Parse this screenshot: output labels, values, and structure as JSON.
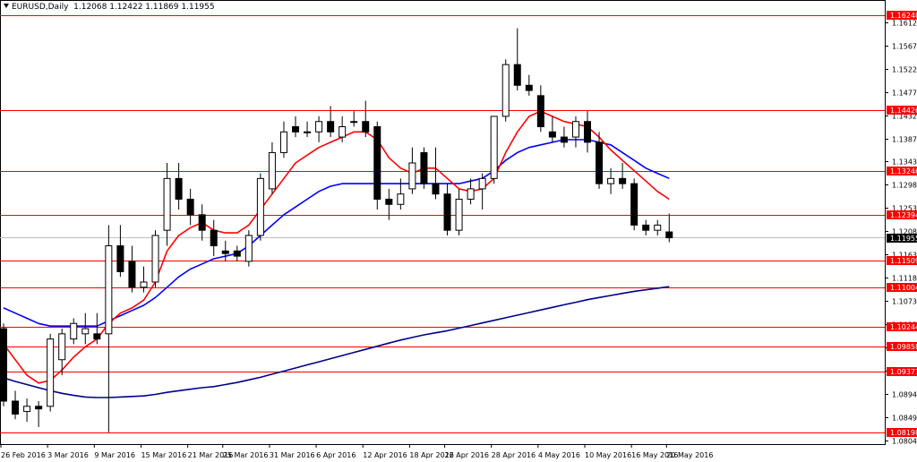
{
  "header": {
    "symbol": "EURUSD,Daily",
    "ohlc": "1.12068 1.12422 1.11869 1.11955"
  },
  "colors": {
    "up": "#ffffff",
    "down": "#000000",
    "level_line": "#ff0000",
    "ma_fast": "#ff0000",
    "ma_mid": "#0000ff",
    "ma_slow": "#00008b",
    "current_price_line": "#c0c0c0"
  },
  "chart_data": {
    "type": "candlestick",
    "y_range": [
      1.0797,
      1.1653
    ],
    "price_ticks": [
      "1.16120",
      "1.15670",
      "1.15220",
      "1.14770",
      "1.14320",
      "1.13870",
      "1.13430",
      "1.12980",
      "1.12530",
      "1.12080",
      "1.11630",
      "1.11180",
      "1.10730",
      "1.10280",
      "1.09840",
      "1.09390",
      "1.08940",
      "1.08490",
      "1.08040"
    ],
    "levels": [
      "1.16248",
      "1.14426",
      "1.13246",
      "1.12394",
      "1.11509",
      "1.11004",
      "1.10244",
      "1.09858",
      "1.09377",
      "1.08198"
    ],
    "current_price": "1.11955",
    "date_labels": [
      "26 Feb 2016",
      "3 Mar 2016",
      "9 Mar 2016",
      "15 Mar 2016",
      "21 Mar 2016",
      "25 Mar 2016",
      "31 Mar 2016",
      "6 Apr 2016",
      "12 Apr 2016",
      "18 Apr 2016",
      "22 Apr 2016",
      "28 Apr 2016",
      "4 May 2016",
      "10 May 2016",
      "16 May 2016",
      "20 May 2016"
    ],
    "date_label_index": [
      0,
      4,
      8,
      12,
      16,
      19,
      23,
      27,
      31,
      35,
      38,
      42,
      46,
      50,
      54,
      57
    ],
    "candles": [
      [
        1.102,
        1.103,
        1.087,
        1.088
      ],
      [
        1.088,
        1.09,
        1.0845,
        1.0855
      ],
      [
        1.086,
        1.0885,
        1.084,
        1.087
      ],
      [
        1.087,
        1.088,
        1.083,
        1.0865
      ],
      [
        1.087,
        1.101,
        1.086,
        1.1
      ],
      [
        1.096,
        1.102,
        1.093,
        1.101
      ],
      [
        1.1,
        1.104,
        1.099,
        1.103
      ],
      [
        1.101,
        1.105,
        1.099,
        1.102
      ],
      [
        1.101,
        1.105,
        1.099,
        1.1
      ],
      [
        1.101,
        1.122,
        1.082,
        1.118
      ],
      [
        1.118,
        1.122,
        1.112,
        1.113
      ],
      [
        1.115,
        1.118,
        1.109,
        1.11
      ],
      [
        1.11,
        1.114,
        1.109,
        1.111
      ],
      [
        1.111,
        1.121,
        1.11,
        1.12
      ],
      [
        1.121,
        1.134,
        1.118,
        1.131
      ],
      [
        1.131,
        1.134,
        1.125,
        1.127
      ],
      [
        1.127,
        1.129,
        1.122,
        1.124
      ],
      [
        1.124,
        1.126,
        1.119,
        1.121
      ],
      [
        1.121,
        1.123,
        1.116,
        1.118
      ],
      [
        1.117,
        1.119,
        1.115,
        1.1165
      ],
      [
        1.117,
        1.118,
        1.115,
        1.116
      ],
      [
        1.115,
        1.121,
        1.114,
        1.12
      ],
      [
        1.12,
        1.132,
        1.119,
        1.131
      ],
      [
        1.129,
        1.138,
        1.128,
        1.136
      ],
      [
        1.136,
        1.142,
        1.135,
        1.14
      ],
      [
        1.141,
        1.143,
        1.139,
        1.14
      ],
      [
        1.14,
        1.142,
        1.139,
        1.14
      ],
      [
        1.14,
        1.143,
        1.138,
        1.142
      ],
      [
        1.142,
        1.145,
        1.139,
        1.14
      ],
      [
        1.139,
        1.143,
        1.138,
        1.141
      ],
      [
        1.142,
        1.144,
        1.141,
        1.142
      ],
      [
        1.142,
        1.146,
        1.139,
        1.14
      ],
      [
        1.141,
        1.142,
        1.125,
        1.127
      ],
      [
        1.127,
        1.129,
        1.123,
        1.126
      ],
      [
        1.126,
        1.131,
        1.125,
        1.128
      ],
      [
        1.129,
        1.137,
        1.128,
        1.134
      ],
      [
        1.136,
        1.137,
        1.129,
        1.13
      ],
      [
        1.13,
        1.137,
        1.127,
        1.128
      ],
      [
        1.128,
        1.13,
        1.12,
        1.121
      ],
      [
        1.121,
        1.129,
        1.12,
        1.127
      ],
      [
        1.127,
        1.131,
        1.126,
        1.129
      ],
      [
        1.129,
        1.132,
        1.125,
        1.131
      ],
      [
        1.131,
        1.142,
        1.13,
        1.143
      ],
      [
        1.143,
        1.154,
        1.142,
        1.153
      ],
      [
        1.153,
        1.16,
        1.148,
        1.149
      ],
      [
        1.149,
        1.151,
        1.147,
        1.148
      ],
      [
        1.147,
        1.149,
        1.14,
        1.141
      ],
      [
        1.14,
        1.143,
        1.138,
        1.139
      ],
      [
        1.139,
        1.141,
        1.137,
        1.138
      ],
      [
        1.139,
        1.143,
        1.137,
        1.142
      ],
      [
        1.142,
        1.144,
        1.136,
        1.138
      ],
      [
        1.138,
        1.14,
        1.129,
        1.13
      ],
      [
        1.13,
        1.133,
        1.128,
        1.131
      ],
      [
        1.131,
        1.134,
        1.129,
        1.13
      ],
      [
        1.13,
        1.131,
        1.121,
        1.122
      ],
      [
        1.122,
        1.123,
        1.12,
        1.121
      ],
      [
        1.121,
        1.123,
        1.12,
        1.122
      ],
      [
        1.12068,
        1.12422,
        1.11869,
        1.11955
      ]
    ],
    "ma_fast": [
      1.099,
      1.096,
      1.093,
      1.0915,
      1.092,
      1.094,
      1.0965,
      1.0985,
      1.1,
      1.103,
      1.105,
      1.106,
      1.1075,
      1.111,
      1.117,
      1.12,
      1.1215,
      1.1225,
      1.121,
      1.1205,
      1.1205,
      1.122,
      1.125,
      1.128,
      1.131,
      1.134,
      1.1355,
      1.137,
      1.138,
      1.139,
      1.14,
      1.14,
      1.1385,
      1.135,
      1.133,
      1.132,
      1.133,
      1.133,
      1.131,
      1.129,
      1.1285,
      1.129,
      1.131,
      1.136,
      1.14,
      1.143,
      1.144,
      1.143,
      1.142,
      1.1415,
      1.141,
      1.139,
      1.1365,
      1.1345,
      1.1325,
      1.1305,
      1.1285,
      1.127
    ],
    "ma_mid": [
      1.106,
      1.105,
      1.104,
      1.103,
      1.1025,
      1.1025,
      1.1025,
      1.1025,
      1.1025,
      1.1035,
      1.1045,
      1.1055,
      1.1065,
      1.108,
      1.11,
      1.112,
      1.1135,
      1.1145,
      1.1155,
      1.116,
      1.1165,
      1.118,
      1.12,
      1.122,
      1.124,
      1.1255,
      1.127,
      1.1285,
      1.1295,
      1.13,
      1.13,
      1.13,
      1.13,
      1.13,
      1.13,
      1.13,
      1.13,
      1.13,
      1.13,
      1.13,
      1.1305,
      1.131,
      1.1325,
      1.1345,
      1.136,
      1.137,
      1.1375,
      1.138,
      1.1385,
      1.1385,
      1.1385,
      1.138,
      1.1375,
      1.136,
      1.1345,
      1.133,
      1.132,
      1.131
    ],
    "ma_slow": [
      1.0925,
      1.0918,
      1.0912,
      1.0906,
      1.09,
      1.0895,
      1.0891,
      1.0888,
      1.0887,
      1.0887,
      1.0888,
      1.0889,
      1.089,
      1.0893,
      1.0897,
      1.09,
      1.0903,
      1.0906,
      1.0908,
      1.0912,
      1.0916,
      1.0921,
      1.0926,
      1.0932,
      1.0938,
      1.0944,
      1.095,
      1.0956,
      1.0962,
      1.0968,
      1.0974,
      1.098,
      1.0986,
      1.0992,
      1.0998,
      1.1003,
      1.1008,
      1.1012,
      1.1016,
      1.1021,
      1.1026,
      1.1031,
      1.1036,
      1.1041,
      1.1046,
      1.1051,
      1.1056,
      1.1061,
      1.1066,
      1.1071,
      1.1076,
      1.108,
      1.1084,
      1.1088,
      1.1092,
      1.1095,
      1.1098,
      1.1101
    ]
  }
}
